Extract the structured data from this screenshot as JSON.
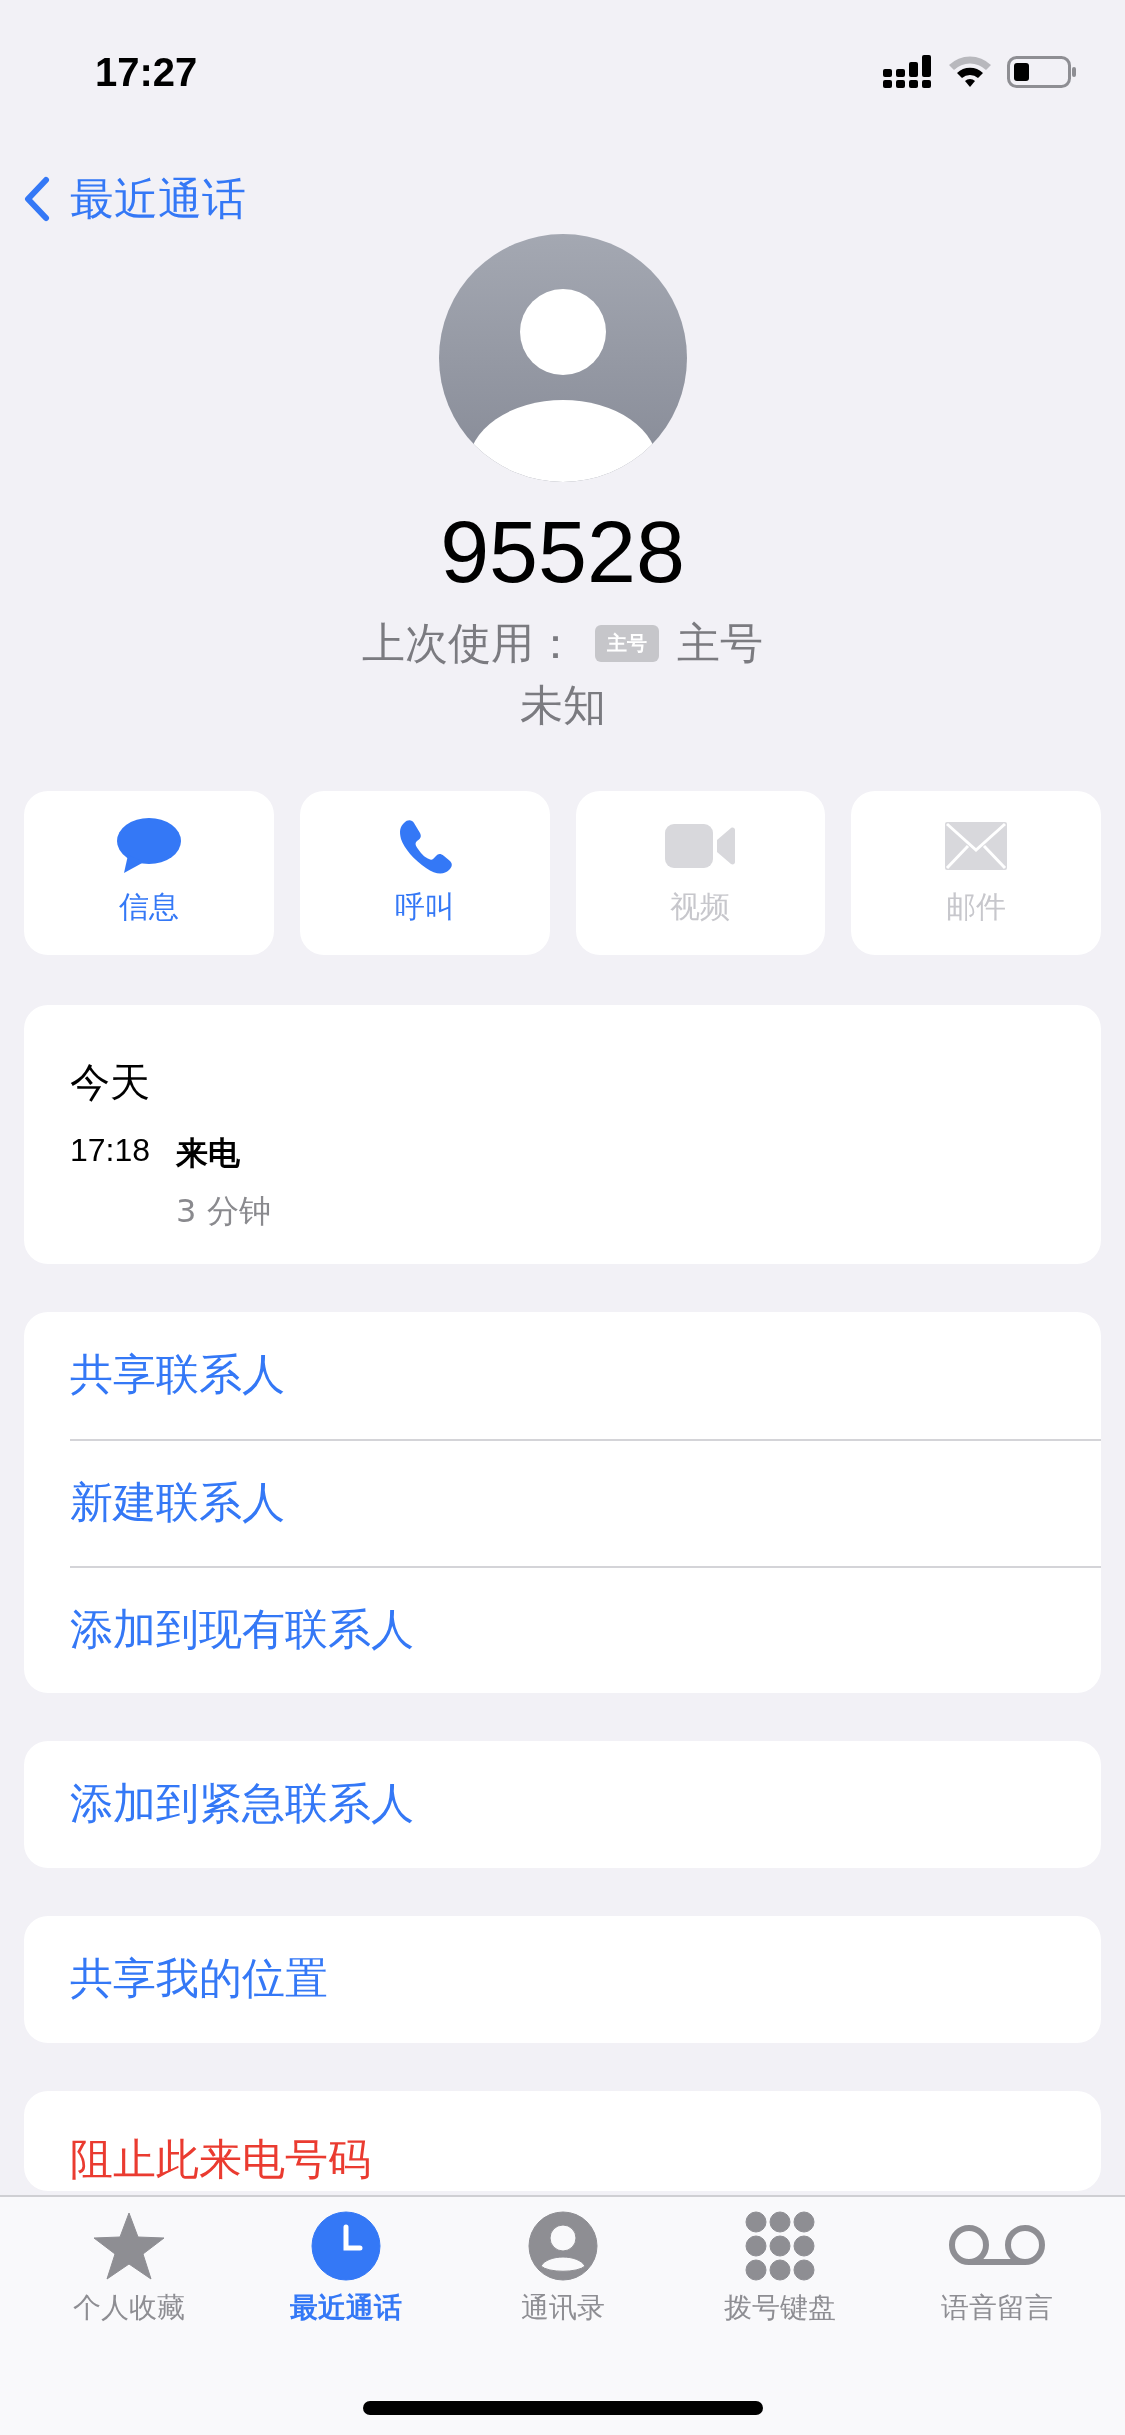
{
  "status_bar": {
    "time": "17:27"
  },
  "nav": {
    "back_label": "最近通话"
  },
  "contact": {
    "number": "95528",
    "last_used_label": "上次使用：",
    "line_badge": "主号",
    "line_name": "主号",
    "location": "未知"
  },
  "actions": [
    {
      "kind": "message",
      "label": "信息",
      "disabled": false
    },
    {
      "kind": "call",
      "label": "呼叫",
      "disabled": false
    },
    {
      "kind": "video",
      "label": "视频",
      "disabled": true
    },
    {
      "kind": "mail",
      "label": "邮件",
      "disabled": true
    }
  ],
  "call_log": {
    "day": "今天",
    "entries": [
      {
        "time": "17:18",
        "type": "来电",
        "duration": "3 分钟"
      }
    ]
  },
  "groups": [
    [
      {
        "label": "共享联系人",
        "kind": "action"
      },
      {
        "label": "新建联系人",
        "kind": "action"
      },
      {
        "label": "添加到现有联系人",
        "kind": "action"
      }
    ],
    [
      {
        "label": "添加到紧急联系人",
        "kind": "action"
      }
    ],
    [
      {
        "label": "共享我的位置",
        "kind": "action"
      }
    ],
    [
      {
        "label": "阻止此来电号码",
        "kind": "destructive"
      }
    ]
  ],
  "tab_bar": [
    {
      "kind": "favorites",
      "label": "个人收藏",
      "selected": false
    },
    {
      "kind": "recents",
      "label": "最近通话",
      "selected": true
    },
    {
      "kind": "contacts",
      "label": "通讯录",
      "selected": false
    },
    {
      "kind": "keypad",
      "label": "拨号键盘",
      "selected": false
    },
    {
      "kind": "voicemail",
      "label": "语音留言",
      "selected": false
    }
  ]
}
